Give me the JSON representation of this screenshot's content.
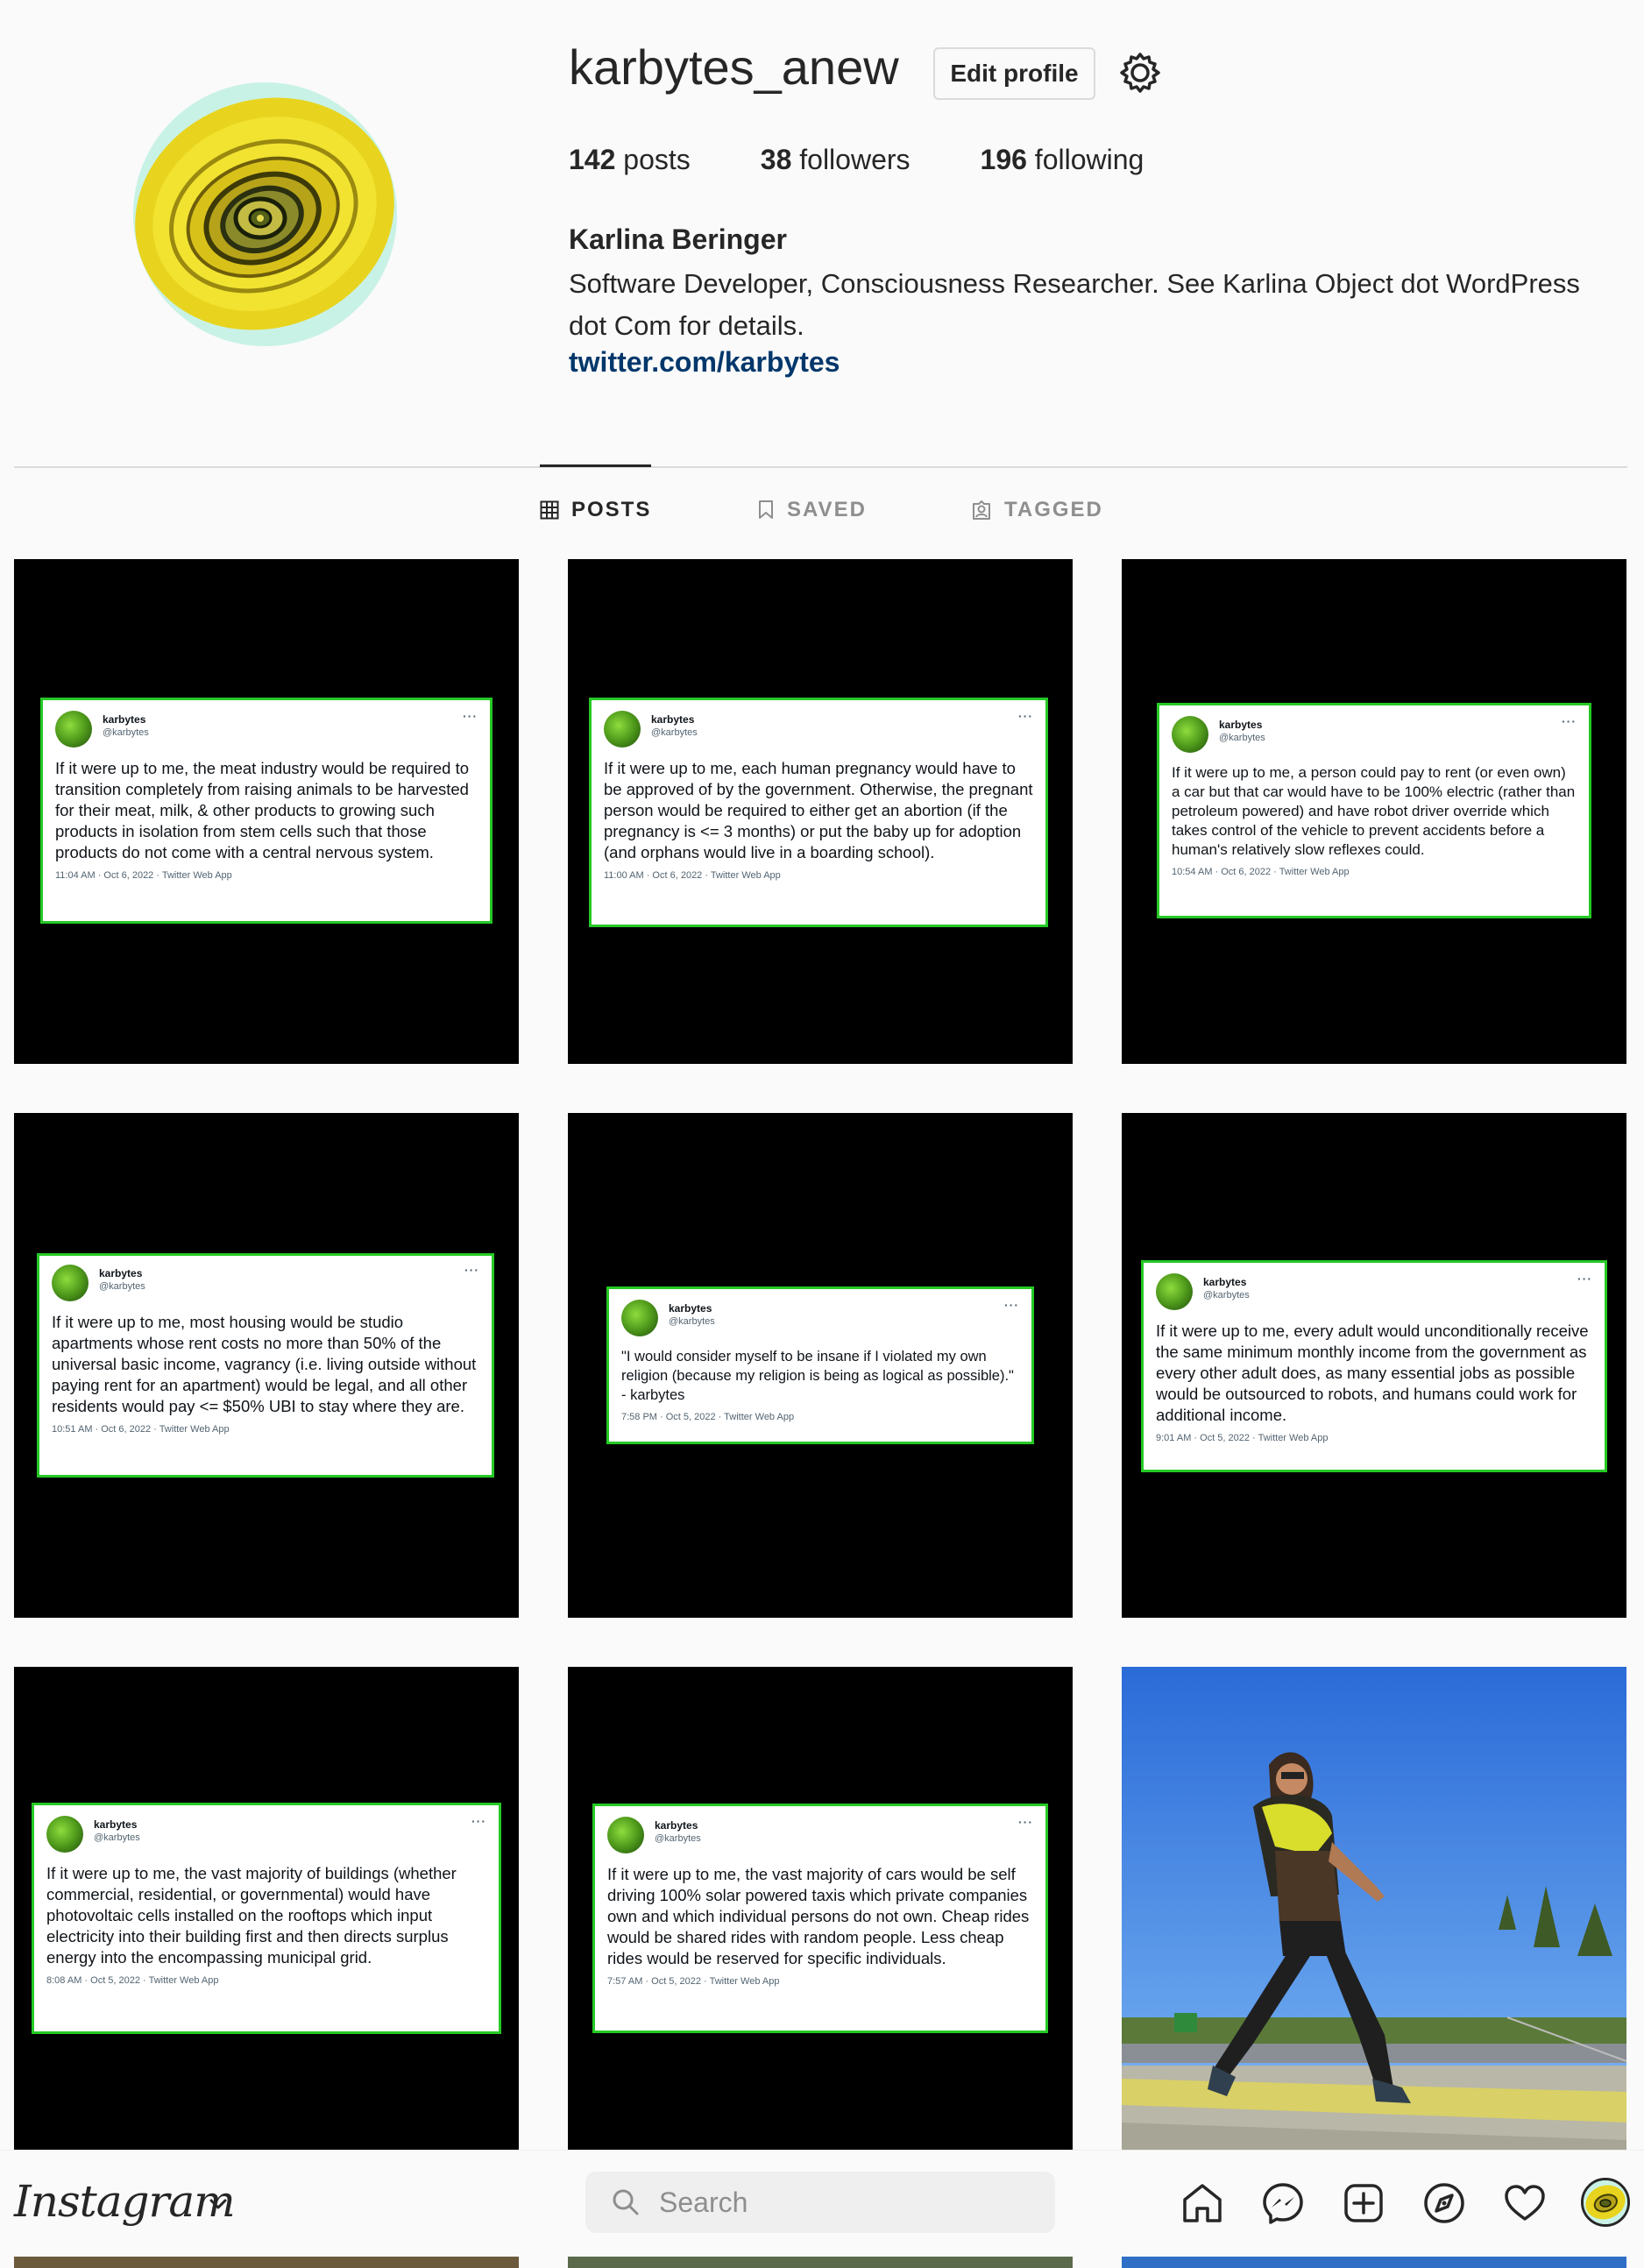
{
  "profile": {
    "username": "karbytes_anew",
    "edit_profile_label": "Edit profile",
    "stats": {
      "posts_count": "142",
      "posts_label": "posts",
      "followers_count": "38",
      "followers_label": "followers",
      "following_count": "196",
      "following_label": "following"
    },
    "full_name": "Karlina Beringer",
    "bio": "Software Developer, Consciousness Researcher. See Karlina Object dot WordPress dot Com for details.",
    "link": "twitter.com/karbytes"
  },
  "tabs": [
    {
      "label": "POSTS",
      "active": true
    },
    {
      "label": "SAVED",
      "active": false
    },
    {
      "label": "TAGGED",
      "active": false
    }
  ],
  "posts": [
    {
      "name": "karbytes",
      "handle": "@karbytes",
      "text": "If it were up to me, the meat industry would be required to transition completely from raising animals to be harvested for their meat, milk, & other products to growing such products in isolation from stem cells such that those products do not come with a central nervous system.",
      "meta": "11:04 AM · Oct 6, 2022 · Twitter Web App"
    },
    {
      "name": "karbytes",
      "handle": "@karbytes",
      "text": "If it were up to me, each human pregnancy would have to be approved of by the government. Otherwise, the pregnant person would be required to either get an abortion (if the pregnancy is <= 3 months) or put the baby up for adoption (and orphans would live in a boarding school).",
      "meta": "11:00 AM · Oct 6, 2022 · Twitter Web App"
    },
    {
      "name": "karbytes",
      "handle": "@karbytes",
      "text": "If it were up to me, a person could pay to rent (or even own) a car but that car would have to be 100% electric (rather than petroleum powered) and have robot driver override which takes control of the vehicle to prevent accidents before a human's relatively slow reflexes could.",
      "meta": "10:54 AM · Oct 6, 2022 · Twitter Web App"
    },
    {
      "name": "karbytes",
      "handle": "@karbytes",
      "text": "If it were up to me, most housing would be studio apartments whose rent costs no more than 50% of the universal basic income, vagrancy (i.e. living outside without paying rent for an apartment) would be legal, and all other residents would pay <= $50% UBI to stay where they are.",
      "meta": "10:51 AM · Oct 6, 2022 · Twitter Web App"
    },
    {
      "name": "karbytes",
      "handle": "@karbytes",
      "text": "\"I would consider myself to be insane if I violated my own religion (because my religion is being as logical as possible).\" - karbytes",
      "meta": "7:58 PM · Oct 5, 2022 · Twitter Web App"
    },
    {
      "name": "karbytes",
      "handle": "@karbytes",
      "text": "If it were up to me, every adult would unconditionally receive the same minimum monthly income from the government as every other adult does, as many essential jobs as possible would be outsourced to robots, and humans could work for additional income.",
      "meta": "9:01 AM · Oct 5, 2022 · Twitter Web App"
    },
    {
      "name": "karbytes",
      "handle": "@karbytes",
      "text": "If it were up to me, the vast majority of buildings (whether commercial, residential, or governmental) would have photovoltaic cells installed on the rooftops which input electricity into their building first and then directs surplus energy into the encompassing municipal grid.",
      "meta": "8:08 AM · Oct 5, 2022 · Twitter Web App"
    },
    {
      "name": "karbytes",
      "handle": "@karbytes",
      "text": "If it were up to me, the vast majority of cars would be self driving 100% solar powered taxis which private companies own and which individual persons do not own. Cheap rides would be shared rides with random people. Less cheap rides would be reserved for specific individuals.",
      "meta": "7:57 AM · Oct 5, 2022 · Twitter Web App"
    }
  ],
  "bottom_nav": {
    "logo": "Instagram",
    "search_placeholder": "Search",
    "icons": [
      "home-icon",
      "messenger-icon",
      "new-post-icon",
      "explore-icon",
      "activity-heart-icon",
      "profile-avatar"
    ]
  },
  "colors": {
    "link": "#00376b",
    "tweet_border": "#25c925",
    "background": "#fafafa"
  }
}
